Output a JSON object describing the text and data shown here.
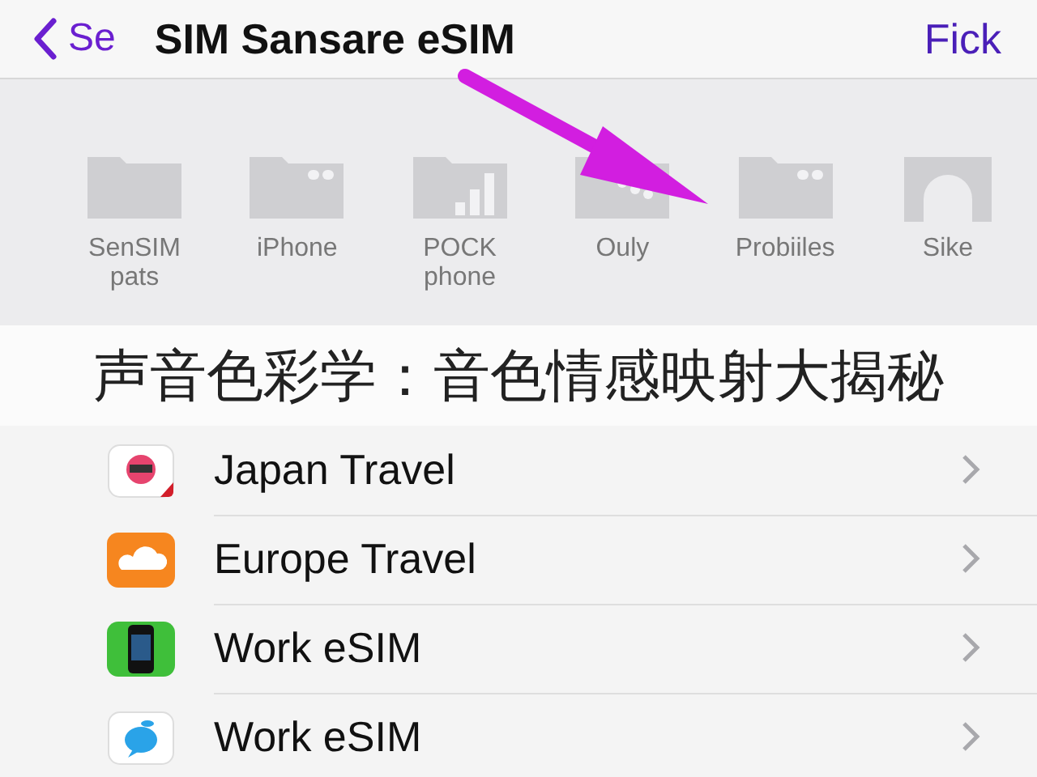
{
  "nav": {
    "back": "Se",
    "title": "SIM Sansare eSIM",
    "action": "Fick"
  },
  "shelf": [
    {
      "label": "SenSIM pats",
      "kind": "folder"
    },
    {
      "label": "iPhone",
      "kind": "folder-dots"
    },
    {
      "label": "POCK phone",
      "kind": "signal"
    },
    {
      "label": "Ouly",
      "kind": "dots"
    },
    {
      "label": "Probiiles",
      "kind": "folder-dots"
    },
    {
      "label": "Sike",
      "kind": "arch"
    }
  ],
  "caption": "声音色彩学：音色情感映射大揭秘",
  "rows": [
    {
      "label": "Japan Travel",
      "kind": "badge"
    },
    {
      "label": "Europe Travel",
      "kind": "cloud"
    },
    {
      "label": "Work eSIM",
      "kind": "phone"
    },
    {
      "label": "Work eSIM",
      "kind": "bubble"
    }
  ]
}
